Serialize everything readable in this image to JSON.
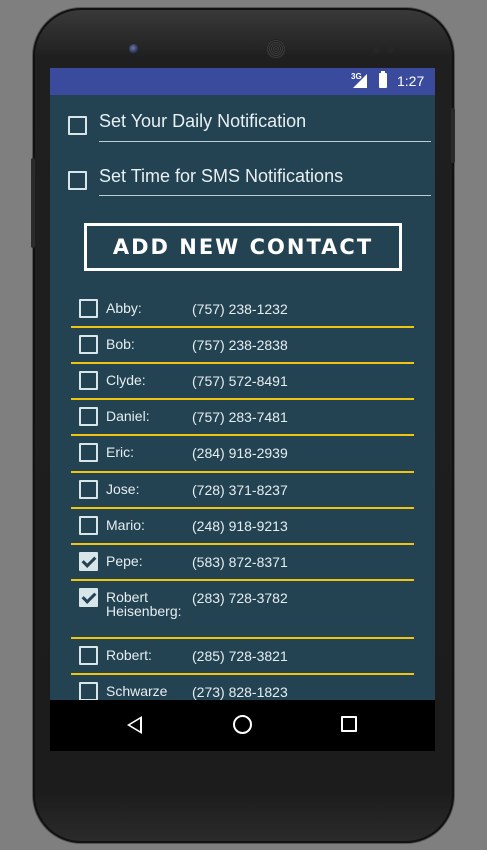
{
  "status_bar": {
    "network": "3G",
    "time": "1:27"
  },
  "settings": [
    {
      "label": "Set Your Daily Notification",
      "checked": false
    },
    {
      "label": "Set Time for SMS Notifications",
      "checked": false
    }
  ],
  "add_contact_label": "ADD NEW CONTACT",
  "contacts": [
    {
      "name": "Abby:",
      "phone": "(757) 238-1232",
      "checked": false
    },
    {
      "name": "Bob:",
      "phone": "(757) 238-2838",
      "checked": false
    },
    {
      "name": "Clyde:",
      "phone": "(757) 572-8491",
      "checked": false
    },
    {
      "name": "Daniel:",
      "phone": "(757) 283-7481",
      "checked": false
    },
    {
      "name": "Eric:",
      "phone": "(284) 918-2939",
      "checked": false
    },
    {
      "name": "Jose:",
      "phone": "(728) 371-8237",
      "checked": false
    },
    {
      "name": "Mario:",
      "phone": "(248) 918-9213",
      "checked": false
    },
    {
      "name": "Pepe:",
      "phone": "(583) 872-8371",
      "checked": true
    },
    {
      "name": "Robert Heisenberg:",
      "phone": "(283) 728-3782",
      "checked": true
    },
    {
      "name": "Robert:",
      "phone": "(285) 728-3821",
      "checked": false
    },
    {
      "name": "Schwarze",
      "phone": "(273) 828-1823",
      "checked": false
    }
  ],
  "nav": {
    "back_icon": "back-icon",
    "home_icon": "home-icon",
    "recents_icon": "recents-icon"
  },
  "colors": {
    "background": "#234252",
    "status_bar": "#3a4b9e",
    "divider": "#f1c40f"
  }
}
